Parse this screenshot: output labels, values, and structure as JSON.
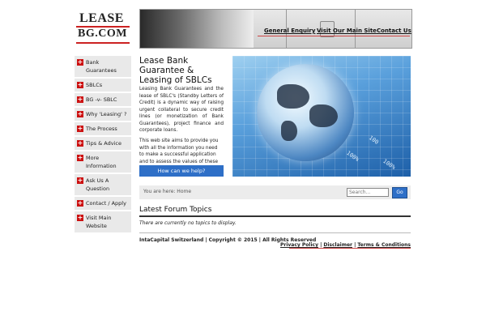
{
  "logo": {
    "line1": "LEASE",
    "line2": "BG.COM"
  },
  "header_nav": [
    {
      "label": "General Enquiry"
    },
    {
      "label": "Visit Our Main Site"
    },
    {
      "label": "Contact Us"
    }
  ],
  "sidebar": {
    "items": [
      {
        "label": "Bank Guarantees"
      },
      {
        "label": "SBLCs"
      },
      {
        "label": "BG -v- SBLC"
      },
      {
        "label": "Why 'Leasing' ?"
      },
      {
        "label": "The Process"
      },
      {
        "label": "Tips & Advice"
      },
      {
        "label": "More Information"
      },
      {
        "label": "Ask Us A Question"
      },
      {
        "label": "Contact / Apply"
      },
      {
        "label": "Visit Main Website"
      }
    ]
  },
  "intro": {
    "title": "Lease Bank Guarantee & Leasing of SBLCs",
    "paragraph1": "Leasing Bank Guarantees and the lease of SBLC's (Standby Letters of Credit) is a dynamic way of raising urgent collateral to secure credit lines (or monetization of Bank Guarantees), project finance and corporate loans.",
    "paragraph2": "This web site aims to provide you with all the information you need to make a successful application and to assess the values of these Collateral",
    "help_button": "How can we help?"
  },
  "hero_image": {
    "digits": [
      "100%",
      "100",
      "100%"
    ]
  },
  "breadcrumb": {
    "text": "You are here: Home"
  },
  "search": {
    "placeholder": "Search...",
    "button": "Go"
  },
  "forum": {
    "title": "Latest Forum Topics",
    "empty_text": "There are currently no topics to display."
  },
  "footer": {
    "copyright": "IntaCapital Switzerland | Copyright © 2015 | All Rights Reserved",
    "links": [
      {
        "label": "Privacy Policy"
      },
      {
        "label": "Disclaimer"
      },
      {
        "label": "Terms & Conditions"
      }
    ],
    "separator": "|"
  }
}
